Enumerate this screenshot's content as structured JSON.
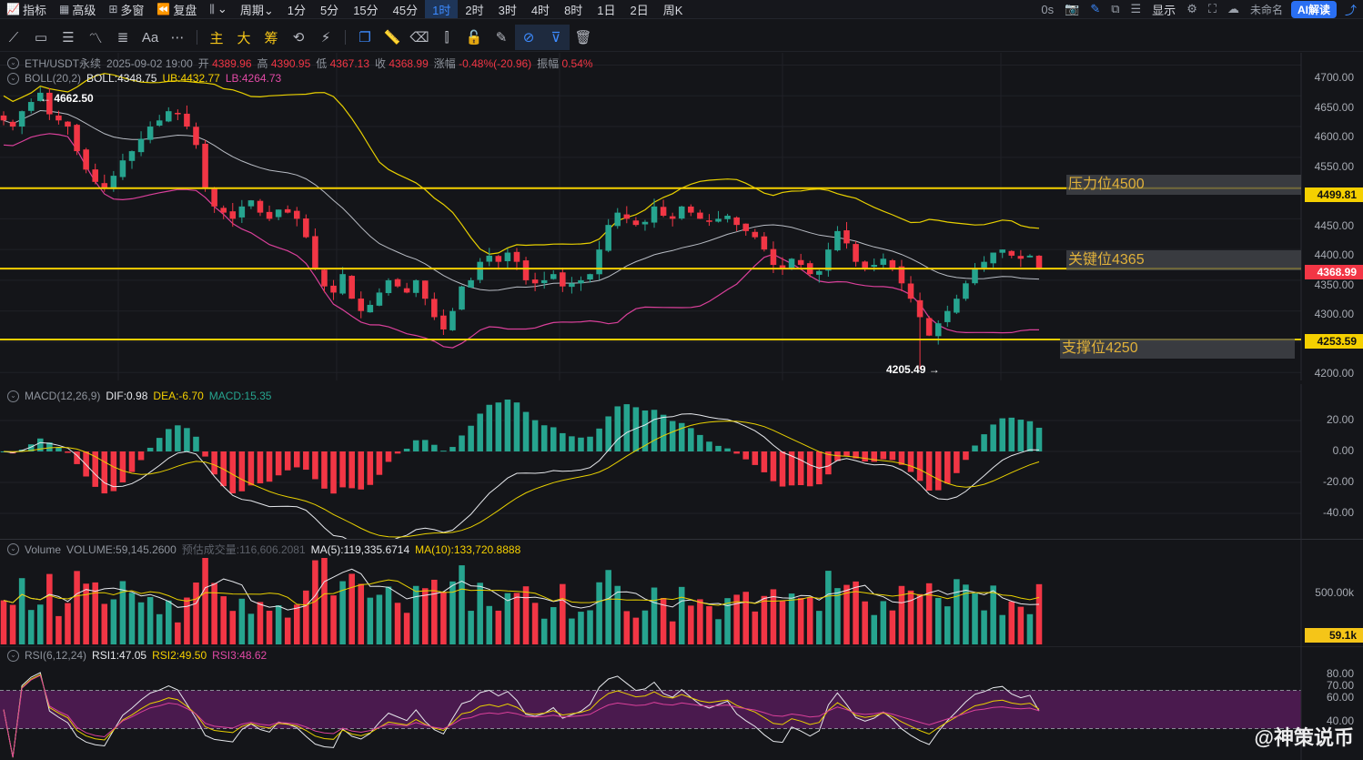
{
  "topbar": {
    "left_items": [
      {
        "label": "指标",
        "icon": "indicator-icon"
      },
      {
        "label": "高级",
        "icon": "calendar-icon"
      },
      {
        "label": "多窗",
        "icon": "grid-icon"
      },
      {
        "label": "复盘",
        "icon": "replay-icon"
      },
      {
        "label": "⌄",
        "icon": "chart-style-icon"
      },
      {
        "label": "周期⌄",
        "icon": ""
      }
    ],
    "intervals": [
      "1分",
      "5分",
      "15分",
      "45分",
      "1时",
      "2时",
      "3时",
      "4时",
      "8时",
      "1日",
      "2日",
      "周K"
    ],
    "active_interval": "1时",
    "right_items": [
      "0s",
      "显示",
      "未命名"
    ],
    "ai_label": "AI解读"
  },
  "toolbar": {
    "main_labels": [
      "主",
      "大",
      "筹"
    ]
  },
  "legend": {
    "symbol": "ETH/USDT永续",
    "datetime": "2025-09-02 19:00",
    "open_label": "开",
    "open": "4389.96",
    "high_label": "高",
    "high": "4390.95",
    "low_label": "低",
    "low": "4367.13",
    "close_label": "收",
    "close": "4368.99",
    "change_label": "涨幅",
    "change": "-0.48%(-20.96)",
    "amp_label": "振幅",
    "amp": "0.54%",
    "boll_name": "BOLL(20,2)",
    "boll": "BOLL:4348.75",
    "ub": "UB:4432.77",
    "lb": "LB:4264.73"
  },
  "price_axis": [
    "4700.00",
    "4650.00",
    "4600.00",
    "4550.00",
    "4500.00",
    "4450.00",
    "4400.00",
    "4350.00",
    "4300.00",
    "4250.00",
    "4200.00"
  ],
  "price_tags": {
    "resistance_line": "4499.81",
    "current": "4368.99",
    "support_line": "4253.59"
  },
  "annotations": {
    "resistance": "压力位4500",
    "key": "关键位4365",
    "support": "支撑位4250",
    "high_mark": "← 4662.50",
    "low_mark": "4205.49 →"
  },
  "macd": {
    "name": "MACD(12,26,9)",
    "dif": "DIF:0.98",
    "dea": "DEA:-6.70",
    "macd": "MACD:15.35",
    "axis": [
      "20.00",
      "0.00",
      "-20.00",
      "-40.00"
    ]
  },
  "volume": {
    "name": "Volume",
    "vol": "VOLUME:59,145.2600",
    "est_label": "预估成交量:",
    "est": "116,606.2081",
    "ma5": "MA(5):119,335.6714",
    "ma10": "MA(10):133,720.8888",
    "axis": [
      "500.00k"
    ],
    "tag": "59.1k"
  },
  "rsi": {
    "name": "RSI(6,12,24)",
    "rsi1": "RSI1:47.05",
    "rsi2": "RSI2:49.50",
    "rsi3": "RSI3:48.62",
    "axis": [
      "80.00",
      "70.00",
      "60.00",
      "40.00"
    ]
  },
  "watermark": "@神策说币",
  "colors": {
    "up": "#26a48f",
    "down": "#f23645",
    "level_line": "#f5d000",
    "boll_mid": "#b8bcc4",
    "boll_ub": "#e8d000",
    "boll_lb": "#d9409a",
    "rsi_band": "#4a1a4e",
    "accent": "#3d8bff"
  },
  "chart_data": {
    "type": "candlestick",
    "symbol": "ETH/USDT永续",
    "interval": "1时",
    "ylim": [
      4190,
      4720
    ],
    "levels": [
      4499.81,
      4368.99,
      4253.59
    ],
    "last_candle": {
      "open": 4389.96,
      "high": 4390.95,
      "low": 4367.13,
      "close": 4368.99
    },
    "period_high": 4662.5,
    "period_low": 4205.49,
    "close_series": [
      4610,
      4600,
      4625,
      4640,
      4655,
      4620,
      4610,
      4600,
      4560,
      4530,
      4510,
      4500,
      4520,
      4545,
      4560,
      4580,
      4600,
      4610,
      4625,
      4620,
      4600,
      4570,
      4500,
      4470,
      4460,
      4450,
      4470,
      4480,
      4460,
      4450,
      4465,
      4460,
      4450,
      4420,
      4370,
      4340,
      4330,
      4360,
      4320,
      4300,
      4310,
      4330,
      4350,
      4340,
      4330,
      4350,
      4320,
      4290,
      4270,
      4300,
      4340,
      4350,
      4380,
      4390,
      4380,
      4395,
      4380,
      4350,
      4345,
      4350,
      4360,
      4340,
      4345,
      4350,
      4360,
      4400,
      4440,
      4460,
      4450,
      4440,
      4445,
      4470,
      4455,
      4450,
      4470,
      4460,
      4450,
      4445,
      4450,
      4455,
      4440,
      4430,
      4420,
      4400,
      4375,
      4370,
      4385,
      4375,
      4360,
      4365,
      4400,
      4430,
      4410,
      4380,
      4370,
      4375,
      4385,
      4370,
      4345,
      4320,
      4290,
      4260,
      4280,
      4300,
      4320,
      4345,
      4370,
      4380,
      4395,
      4400,
      4390,
      4385,
      4390,
      4369
    ]
  }
}
